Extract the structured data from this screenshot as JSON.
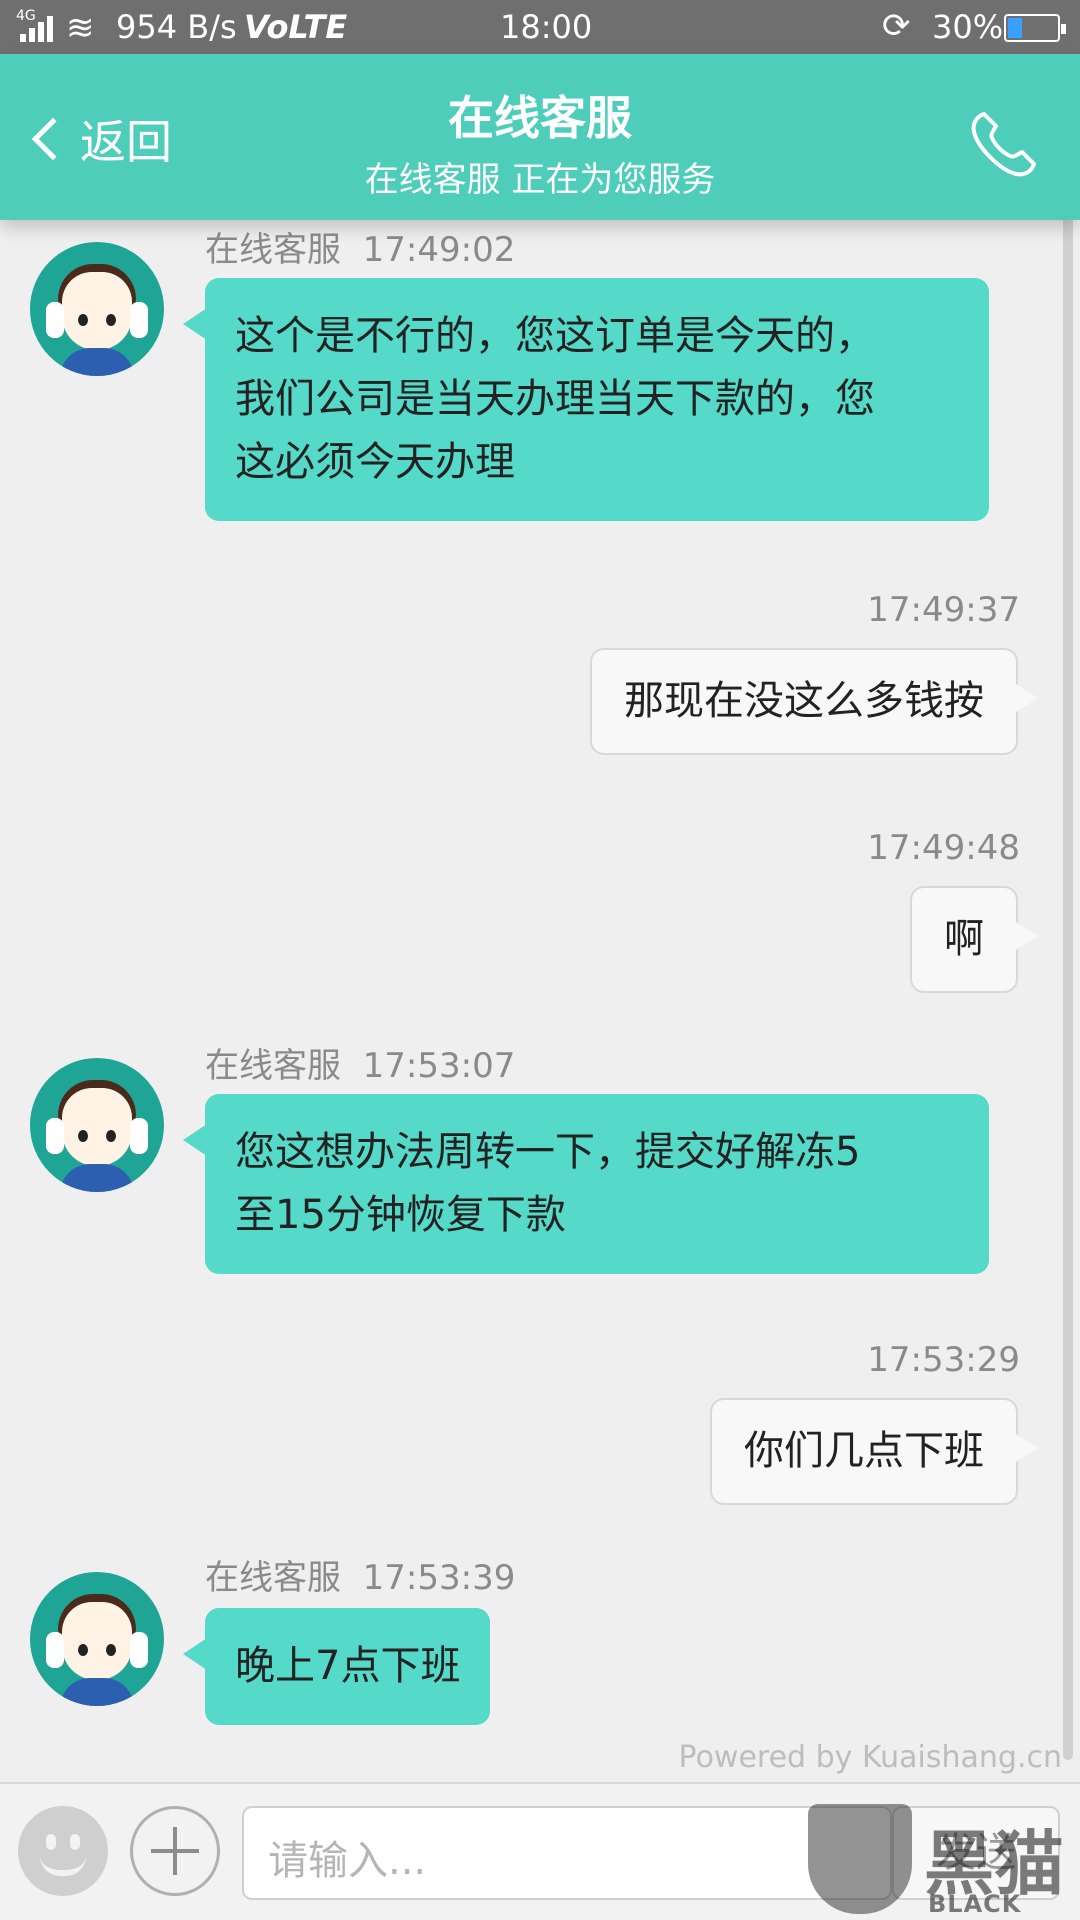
{
  "status_bar": {
    "network": "4G",
    "speed": "954 B/s",
    "volte": "VoLTE",
    "time": "18:00",
    "battery_percent": "30%",
    "battery_level": 0.3,
    "icons": [
      "signal-icon",
      "wifi-icon",
      "rotation-lock-icon",
      "battery-icon"
    ]
  },
  "header": {
    "back_label": "返回",
    "title": "在线客服",
    "subtitle": "在线客服 正在为您服务",
    "phone_icon": "phone-icon",
    "accent_color": "#4fcdbb"
  },
  "messages": [
    {
      "from": "agent",
      "sender": "在线客服",
      "time": "17:49:02",
      "lines": [
        "这个是不行的，您这订单是今天的，",
        "我们公司是当天办理当天下款的，您",
        "这必须今天办理"
      ]
    },
    {
      "from": "user",
      "time": "17:49:37",
      "lines": [
        "那现在没这么多钱按"
      ]
    },
    {
      "from": "user",
      "time": "17:49:48",
      "lines": [
        "啊"
      ]
    },
    {
      "from": "agent",
      "sender": "在线客服",
      "time": "17:53:07",
      "lines": [
        "您这想办法周转一下，提交好解冻5",
        "至15分钟恢复下款"
      ]
    },
    {
      "from": "user",
      "time": "17:53:29",
      "lines": [
        "你们几点下班"
      ]
    },
    {
      "from": "agent",
      "sender": "在线客服",
      "time": "17:53:39",
      "lines": [
        "晚上7点下班"
      ]
    }
  ],
  "footer": {
    "powered_by": "Powered by Kuaishang.cn",
    "input_placeholder": "请输入...",
    "send_label": "发送",
    "emoji_icon": "emoji-icon",
    "plus_icon": "plus-icon"
  },
  "watermark": {
    "text": "黑猫",
    "sub": "BLACK CAT"
  },
  "colors": {
    "agent_bubble": "#55d9c8",
    "user_bubble": "#f8f8f8"
  }
}
